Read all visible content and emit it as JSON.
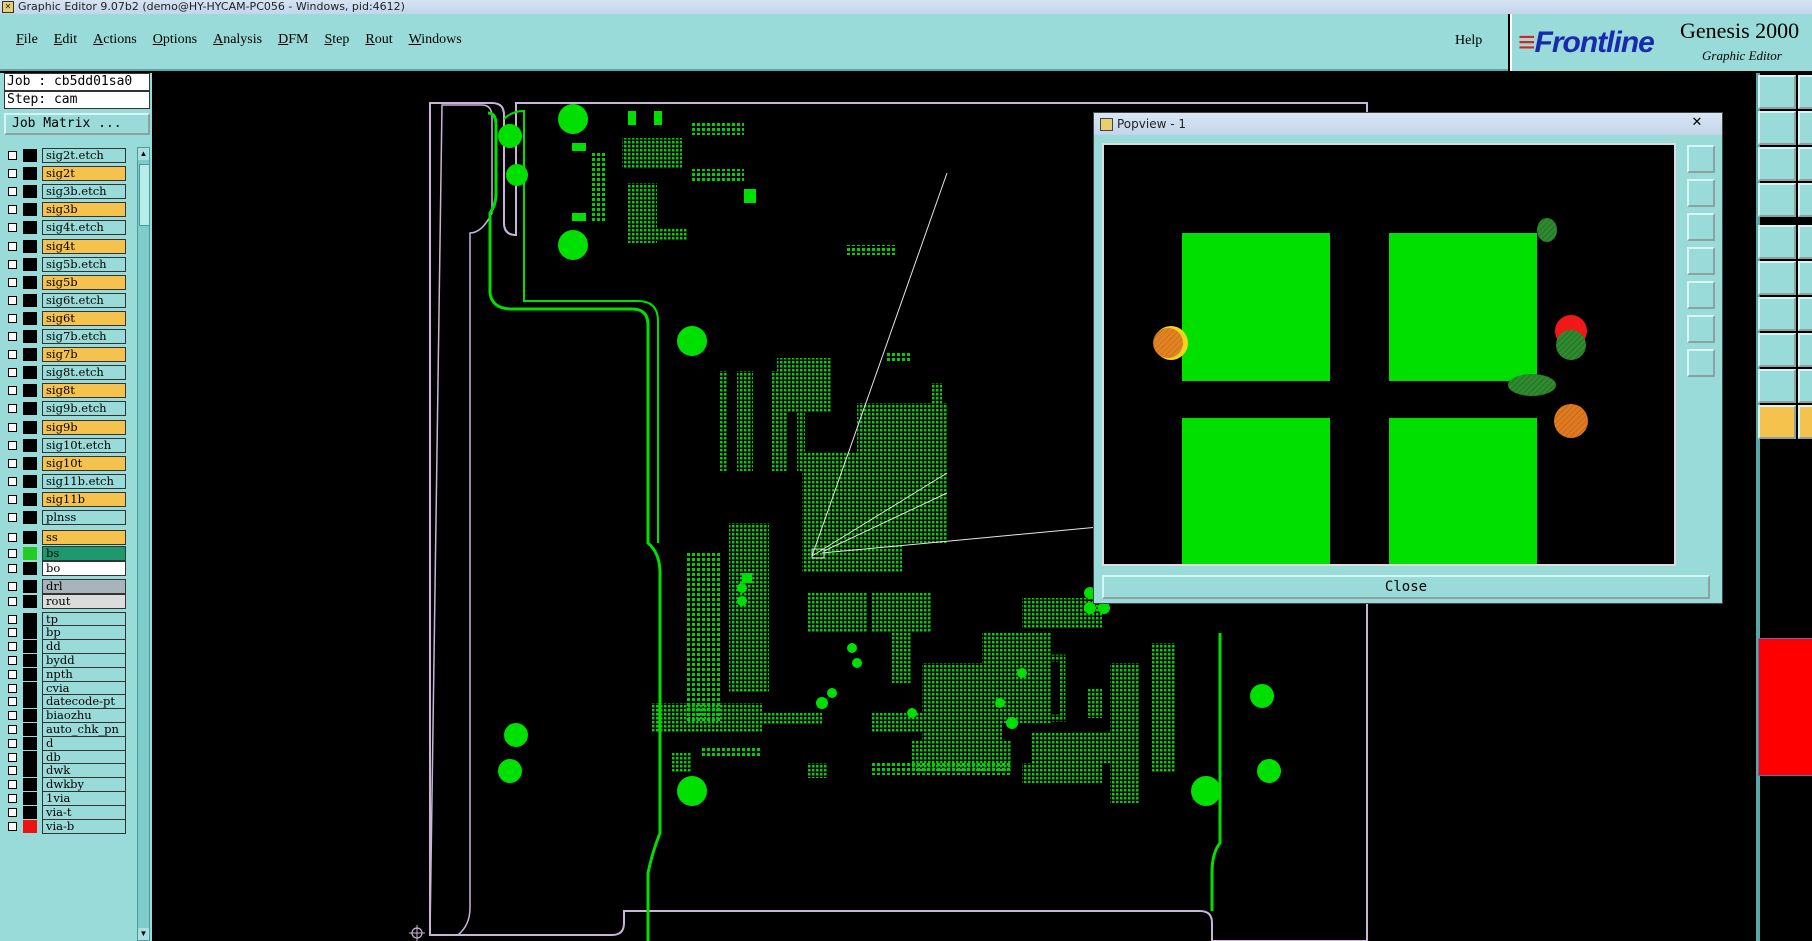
{
  "window": {
    "title": "Graphic Editor 9.07b2 (demo@HY-HYCAM-PC056 - Windows, pid:4612)"
  },
  "menu": {
    "items": [
      {
        "label": "File"
      },
      {
        "label": "Edit"
      },
      {
        "label": "Actions"
      },
      {
        "label": "Options"
      },
      {
        "label": "Analysis"
      },
      {
        "label": "DFM"
      },
      {
        "label": "Step"
      },
      {
        "label": "Rout"
      },
      {
        "label": "Windows"
      }
    ],
    "help": "Help"
  },
  "brand": {
    "logo": "Frontline",
    "product": "Genesis 2000",
    "subtitle": "Graphic Editor"
  },
  "job_panel": {
    "job": "Job : cb5dd01sa0",
    "step": "Step: cam",
    "job_matrix_label": "Job Matrix ..."
  },
  "layers": [
    {
      "name": "sig2t.etch",
      "bg": "#98dbd9"
    },
    {
      "name": "sig2t",
      "bg": "#f5c24e"
    },
    {
      "name": "sig3b.etch",
      "bg": "#98dbd9"
    },
    {
      "name": "sig3b",
      "bg": "#f5c24e"
    },
    {
      "name": "sig4t.etch",
      "bg": "#98dbd9"
    },
    {
      "name": "sig4t",
      "bg": "#f5c24e"
    },
    {
      "name": "sig5b.etch",
      "bg": "#98dbd9"
    },
    {
      "name": "sig5b",
      "bg": "#f5c24e"
    },
    {
      "name": "sig6t.etch",
      "bg": "#98dbd9"
    },
    {
      "name": "sig6t",
      "bg": "#f5c24e"
    },
    {
      "name": "sig7b.etch",
      "bg": "#98dbd9"
    },
    {
      "name": "sig7b",
      "bg": "#f5c24e"
    },
    {
      "name": "sig8t.etch",
      "bg": "#98dbd9"
    },
    {
      "name": "sig8t",
      "bg": "#f5c24e"
    },
    {
      "name": "sig9b.etch",
      "bg": "#98dbd9"
    },
    {
      "name": "sig9b",
      "bg": "#f5c24e"
    },
    {
      "name": "sig10t.etch",
      "bg": "#98dbd9"
    },
    {
      "name": "sig10t",
      "bg": "#f5c24e"
    },
    {
      "name": "sig11b.etch",
      "bg": "#98dbd9"
    },
    {
      "name": "sig11b",
      "bg": "#f5c24e"
    },
    {
      "name": "plnss",
      "bg": "#98dbd9"
    },
    {
      "name": "ss",
      "bg": "#f5c24e"
    },
    {
      "name": "bs",
      "bg": "#1c9a6e",
      "sw": "#22cc22"
    },
    {
      "name": "bo",
      "bg": "#ffffff"
    },
    {
      "name": "drl",
      "bg": "#a8b4bc"
    },
    {
      "name": "rout",
      "bg": "#dcdcdc"
    },
    {
      "name": "tp",
      "bg": "#98dbd9"
    },
    {
      "name": "bp",
      "bg": "#98dbd9"
    },
    {
      "name": "dd",
      "bg": "#98dbd9"
    },
    {
      "name": "bydd",
      "bg": "#98dbd9"
    },
    {
      "name": "npth",
      "bg": "#98dbd9"
    },
    {
      "name": "cvia",
      "bg": "#98dbd9"
    },
    {
      "name": "datecode-pt",
      "bg": "#98dbd9"
    },
    {
      "name": "biaozhu",
      "bg": "#98dbd9"
    },
    {
      "name": "auto_chk_pn",
      "bg": "#98dbd9"
    },
    {
      "name": "d",
      "bg": "#98dbd9"
    },
    {
      "name": "db",
      "bg": "#98dbd9"
    },
    {
      "name": "dwk",
      "bg": "#98dbd9"
    },
    {
      "name": "dwkby",
      "bg": "#98dbd9"
    },
    {
      "name": "1via",
      "bg": "#98dbd9"
    },
    {
      "name": "via-t",
      "bg": "#98dbd9"
    },
    {
      "name": "via-b",
      "bg": "#98dbd9",
      "sw": "#ee1111"
    }
  ],
  "popview": {
    "title": "Popview - 1",
    "close_x": "✕",
    "close_label": "Close"
  },
  "colors": {
    "panel": "#98dbd9",
    "copper": "#00e000",
    "outline": "#c8b4d8",
    "affected": "#f5c24e"
  }
}
